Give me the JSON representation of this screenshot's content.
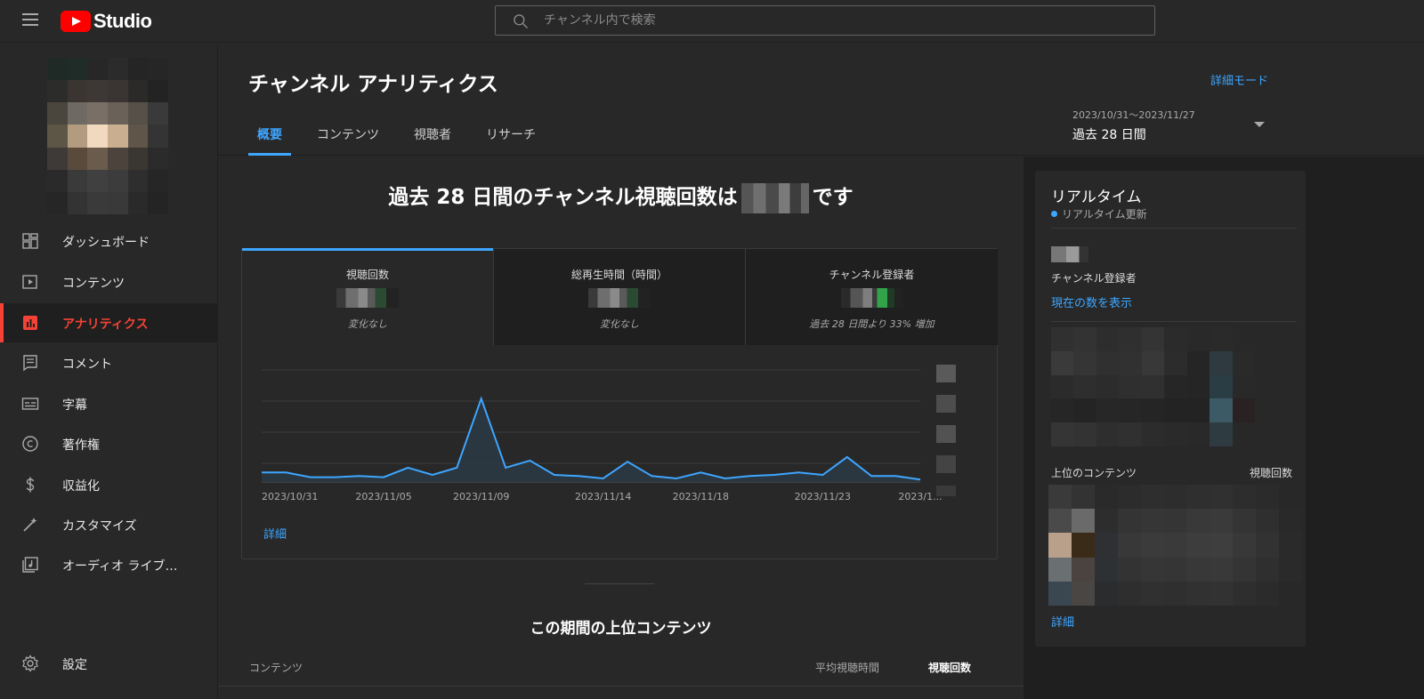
{
  "topbar": {
    "logo_text": "Studio",
    "search_placeholder": "チャンネル内で検索"
  },
  "sidebar": {
    "items": [
      {
        "label": "ダッシュボード",
        "icon": "dashboard-icon"
      },
      {
        "label": "コンテンツ",
        "icon": "content-icon"
      },
      {
        "label": "アナリティクス",
        "icon": "analytics-icon",
        "active": true
      },
      {
        "label": "コメント",
        "icon": "comment-icon"
      },
      {
        "label": "字幕",
        "icon": "subtitles-icon"
      },
      {
        "label": "著作権",
        "icon": "copyright-icon"
      },
      {
        "label": "収益化",
        "icon": "monetization-icon"
      },
      {
        "label": "カスタマイズ",
        "icon": "customize-icon"
      },
      {
        "label": "オーディオ ライブ…",
        "icon": "audio-library-icon"
      }
    ],
    "settings_label": "設定"
  },
  "header": {
    "title": "チャンネル アナリティクス",
    "advanced_mode": "詳細モード",
    "tabs": [
      "概要",
      "コンテンツ",
      "視聴者",
      "リサーチ"
    ],
    "active_tab": 0,
    "date_range": {
      "dates": "2023/10/31〜2023/11/27",
      "label": "過去 28 日間"
    }
  },
  "main": {
    "headline_prefix": "過去 28 日間のチャンネル視聴回数は",
    "headline_suffix": "です",
    "metrics": [
      {
        "label": "視聴回数",
        "change": "変化なし"
      },
      {
        "label": "総再生時間（時間）",
        "change": "変化なし"
      },
      {
        "label": "チャンネル登録者",
        "change": "過去 28 日間より 33% 増加"
      }
    ],
    "detail_link": "詳細",
    "top_content_title": "この期間の上位コンテンツ",
    "table_headers": {
      "content": "コンテンツ",
      "avg_view_duration": "平均視聴時間",
      "views": "視聴回数"
    }
  },
  "chart_data": {
    "type": "area",
    "x": [
      "2023/10/31",
      "2023/11/01",
      "2023/11/02",
      "2023/11/03",
      "2023/11/04",
      "2023/11/05",
      "2023/11/06",
      "2023/11/07",
      "2023/11/08",
      "2023/11/09",
      "2023/11/10",
      "2023/11/11",
      "2023/11/12",
      "2023/11/13",
      "2023/11/14",
      "2023/11/15",
      "2023/11/16",
      "2023/11/17",
      "2023/11/18",
      "2023/11/19",
      "2023/11/20",
      "2023/11/21",
      "2023/11/22",
      "2023/11/23",
      "2023/11/24",
      "2023/11/25",
      "2023/11/26",
      "2023/11/27"
    ],
    "values": [
      8,
      8,
      4,
      4,
      5,
      4,
      12,
      6,
      12,
      70,
      12,
      18,
      6,
      5,
      3,
      17,
      5,
      3,
      8,
      3,
      5,
      6,
      8,
      6,
      21,
      5,
      5,
      2
    ],
    "x_tick_labels": [
      "2023/10/31",
      "2023/11/05",
      "2023/11/09",
      "2023/11/14",
      "2023/11/18",
      "2023/11/23",
      "2023/1..."
    ],
    "x_tick_indices": [
      0,
      5,
      9,
      14,
      18,
      23,
      27
    ],
    "ylim": [
      0,
      100
    ],
    "gridlines": 4,
    "line_color": "#3ea6ff",
    "fill_color": "#2a3944",
    "grid": true
  },
  "realtime": {
    "title": "リアルタイム",
    "subtitle": "リアルタイム更新",
    "subscribers_label": "チャンネル登録者",
    "show_count": "現在の数を表示",
    "top_content_label": "上位のコンテンツ",
    "views_label": "視聴回数",
    "detail_link": "詳細"
  },
  "colors": {
    "accent": "#3ea6ff",
    "active_nav": "#f44336",
    "background": "#282828",
    "panel": "#1f1f1f"
  }
}
